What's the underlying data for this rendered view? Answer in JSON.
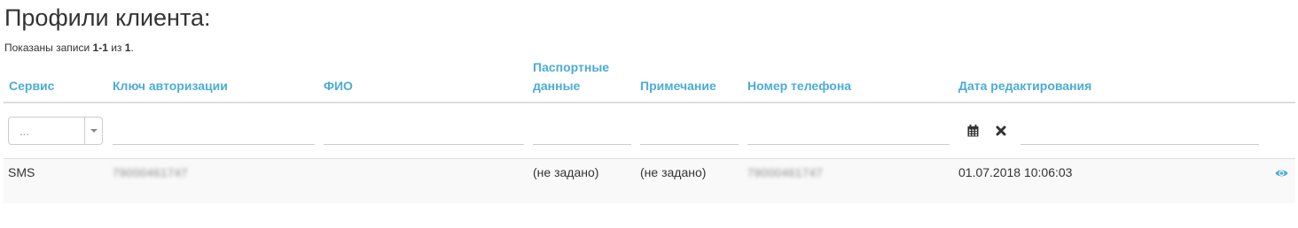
{
  "page": {
    "title": "Профили клиента:",
    "summary": {
      "prefix": "Показаны записи ",
      "range": "1-1",
      "middle": " из ",
      "total": "1",
      "suffix": "."
    }
  },
  "table": {
    "headers": {
      "service": "Сервис",
      "auth_key": "Ключ авторизации",
      "fio": "ФИО",
      "passport_line1": "Паспортные",
      "passport_line2": "данные",
      "note": "Примечание",
      "phone": "Номер телефона",
      "edited": "Дата редактирования"
    },
    "filters": {
      "service_select_value": "...",
      "auth_key": "",
      "fio": "",
      "passport": "",
      "note": "",
      "phone": "",
      "edited": "",
      "calendar_icon": "calendar-icon",
      "clear_icon": "clear-icon"
    },
    "rows": [
      {
        "service": "SMS",
        "auth_key": "79000461747",
        "fio": "",
        "passport": "(не задано)",
        "note": "(не задано)",
        "phone": "79000461747",
        "edited": "01.07.2018 10:06:03",
        "action_icon": "eye-icon"
      }
    ]
  },
  "colors": {
    "accent": "#4bacd6",
    "text": "#333333",
    "row_bg": "#f9f9f9",
    "border": "#dddddd"
  }
}
